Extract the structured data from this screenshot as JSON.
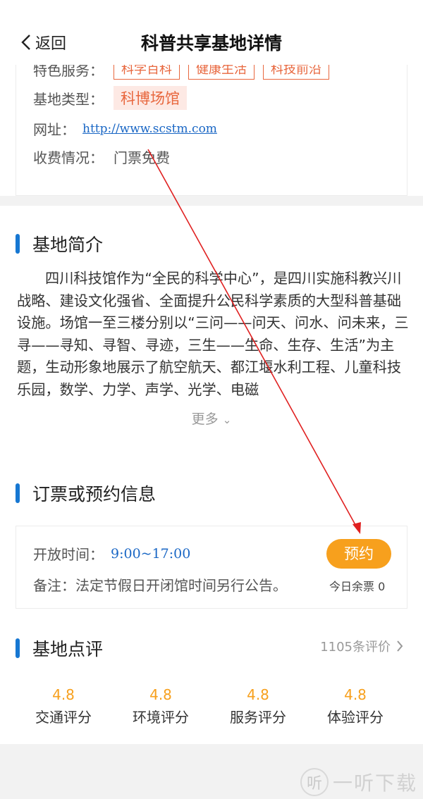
{
  "header": {
    "back_label": "返回",
    "title": "科普共享基地详情"
  },
  "info": {
    "features_label": "特色服务：",
    "feature_tags": [
      "科学百科",
      "健康生活",
      "科技前沿"
    ],
    "type_label": "基地类型：",
    "type_value": "科博场馆",
    "website_label": "网址：",
    "website_value": "http://www.scstm.com",
    "fee_label": "收费情况：",
    "fee_value": "门票免费"
  },
  "intro": {
    "title": "基地简介",
    "text": "四川科技馆作为“全民的科学中心”，是四川实施科教兴川战略、建设文化强省、全面提升公民科学素质的大型科普基础设施。场馆一至三楼分别以“三问——问天、问水、问未来，三寻——寻知、寻智、寻迹，三生——生命、生存、生活”为主题，生动形象地展示了航空航天、都江堰水利工程、儿童科技乐园，数学、力学、声学、光学、电磁",
    "more_label": "更多"
  },
  "booking": {
    "title": "订票或预约信息",
    "open_label": "开放时间：",
    "open_time": "9:00~17:00",
    "note": "备注：法定节假日开闭馆时间另行公告。",
    "reserve_label": "预约",
    "tickets_left": "今日余票 0"
  },
  "reviews": {
    "title": "基地点评",
    "count_label": "1105条评价",
    "scores": [
      {
        "value": "4.8",
        "label": "交通评分"
      },
      {
        "value": "4.8",
        "label": "环境评分"
      },
      {
        "value": "4.8",
        "label": "服务评分"
      },
      {
        "value": "4.8",
        "label": "体验评分"
      }
    ]
  },
  "watermark": {
    "logo_char": "听",
    "text": "一听下载"
  },
  "colors": {
    "accent": "#1677d2",
    "orange": "#f7a01d",
    "tag": "#e8673e",
    "link": "#1a67c5",
    "annotation_arrow": "#e02020"
  }
}
